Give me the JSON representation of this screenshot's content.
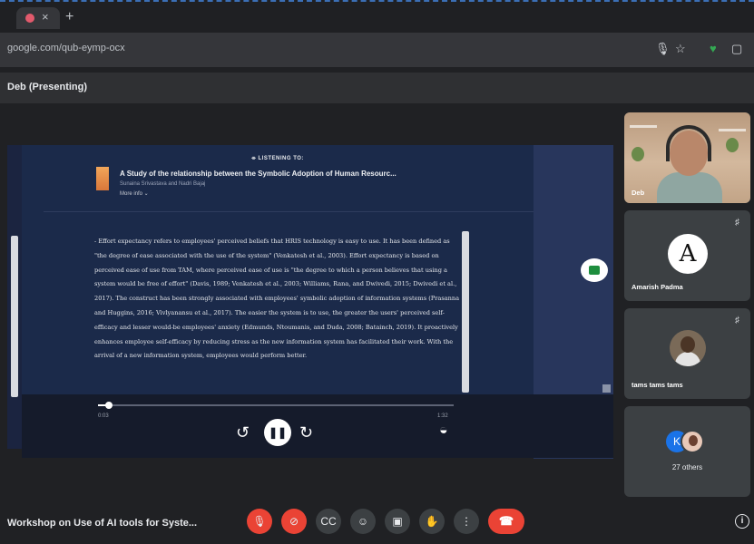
{
  "browser": {
    "url": "google.com/qub-eymp-ocx",
    "icons": [
      "microphone-icon",
      "star-icon",
      "shield-extension-icon",
      "extensions-icon"
    ]
  },
  "meet": {
    "presenter_banner": "Deb (Presenting)",
    "meeting_title": "Workshop on Use of AI tools for Syste..."
  },
  "player": {
    "listening_label": "LISTENING TO:",
    "book_title": "A Study of the relationship between the Symbolic Adoption of Human Resourc...",
    "authors": "Sunaina Srivastava and Nadri Bajaj",
    "more_info": "More info",
    "paragraph": "- Effort expectancy refers to employees' perceived beliefs that HRIS technology is easy to use. It has been defined as \"the degree of ease associated with the use of the system\" (Venkatesh et al., 2003). Effort expectancy is based on perceived ease of use from TAM, where perceived ease of use is \"the degree to which a person believes that using a system would be free of effort\" (Davis, 1989; Venkatesh et al., 2003; Williams, Rana, and Dwivedi, 2015; Dwivedi et al., 2017). The construct has been strongly associated with employees' symbolic adoption of information systems (Prasanna and Huggins, 2016; Vivlyanansu et al., 2017). The easier the system is to use, the greater the users' perceived self-efficacy and lesser would-be employees' anxiety (Edmunds, Ntoumanis, and Duda, 2008; Batainch, 2019). It proactively enhances employee self-efficacy by reducing stress as the new information system has facilitated their work. With the arrival of a new information system, employees would perform better.",
    "time_current": "0:03",
    "time_total": "1:32",
    "progress_fraction": 0.03,
    "play_state": "playing"
  },
  "participants": [
    {
      "name": "Deb"
    },
    {
      "name": "Amarish Padma",
      "avatar_letter": "A"
    },
    {
      "name": "tams tams tams"
    }
  ],
  "others": {
    "label": "27 others",
    "avatar_letter": "K"
  },
  "controls": [
    {
      "name": "mic-muted-icon",
      "glyph": "🎙",
      "color": "#ea4335"
    },
    {
      "name": "camera-off-icon",
      "glyph": "⊘",
      "color": "#ea4335"
    },
    {
      "name": "captions-icon",
      "glyph": "CC",
      "color": "#3c4043"
    },
    {
      "name": "emoji-icon",
      "glyph": "☺",
      "color": "#3c4043"
    },
    {
      "name": "present-icon",
      "glyph": "▣",
      "color": "#3c4043"
    },
    {
      "name": "raise-hand-icon",
      "glyph": "✋",
      "color": "#3c4043"
    },
    {
      "name": "more-options-icon",
      "glyph": "⋮",
      "color": "#3c4043"
    }
  ],
  "leave_call": {
    "glyph": "☎",
    "color": "#ea4335"
  },
  "info_glyph": "i"
}
